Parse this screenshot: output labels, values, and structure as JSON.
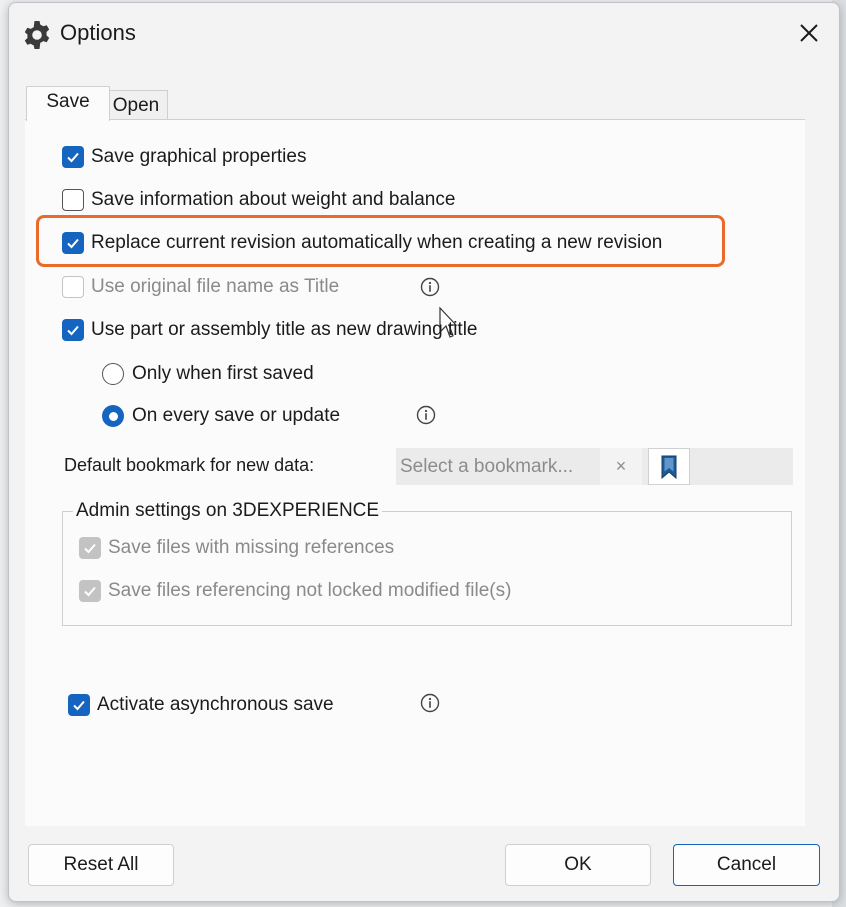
{
  "window": {
    "title": "Options",
    "title_icon": "gear-icon",
    "close_icon": "close-icon"
  },
  "tabs": [
    {
      "label": "Save",
      "active": true
    },
    {
      "label": "Open",
      "active": false
    }
  ],
  "save_tab": {
    "options": [
      {
        "label": "Save graphical properties",
        "checked": true,
        "enabled": true
      },
      {
        "label": "Save information about weight and balance",
        "checked": false,
        "enabled": true
      },
      {
        "label": "Replace current revision automatically when creating a new revision",
        "checked": true,
        "enabled": true,
        "highlighted": true
      },
      {
        "label": "Use original file name as Title",
        "checked": false,
        "enabled": false
      },
      {
        "label": "Use part or assembly title as new drawing title",
        "checked": true,
        "enabled": true
      }
    ],
    "title_mode": {
      "options": [
        {
          "label": "Only when first saved",
          "selected": false
        },
        {
          "label": "On every save or update",
          "selected": true
        }
      ]
    },
    "bookmark": {
      "label": "Default bookmark for new data:",
      "placeholder": "Select a bookmark...",
      "clear_glyph": "×",
      "bookmark_icon": "bookmark-icon"
    },
    "admin_group": {
      "title": "Admin settings on 3DEXPERIENCE",
      "options": [
        {
          "label": "Save files with missing references",
          "checked": true,
          "enabled": false
        },
        {
          "label": "Save files referencing not locked modified file(s)",
          "checked": true,
          "enabled": false
        }
      ]
    },
    "async_save": {
      "label": "Activate asynchronous save",
      "checked": true
    }
  },
  "footer": {
    "reset_label": "Reset All",
    "ok_label": "OK",
    "cancel_label": "Cancel"
  },
  "colors": {
    "accent": "#1565c0",
    "highlight": "#ea6a2a"
  }
}
